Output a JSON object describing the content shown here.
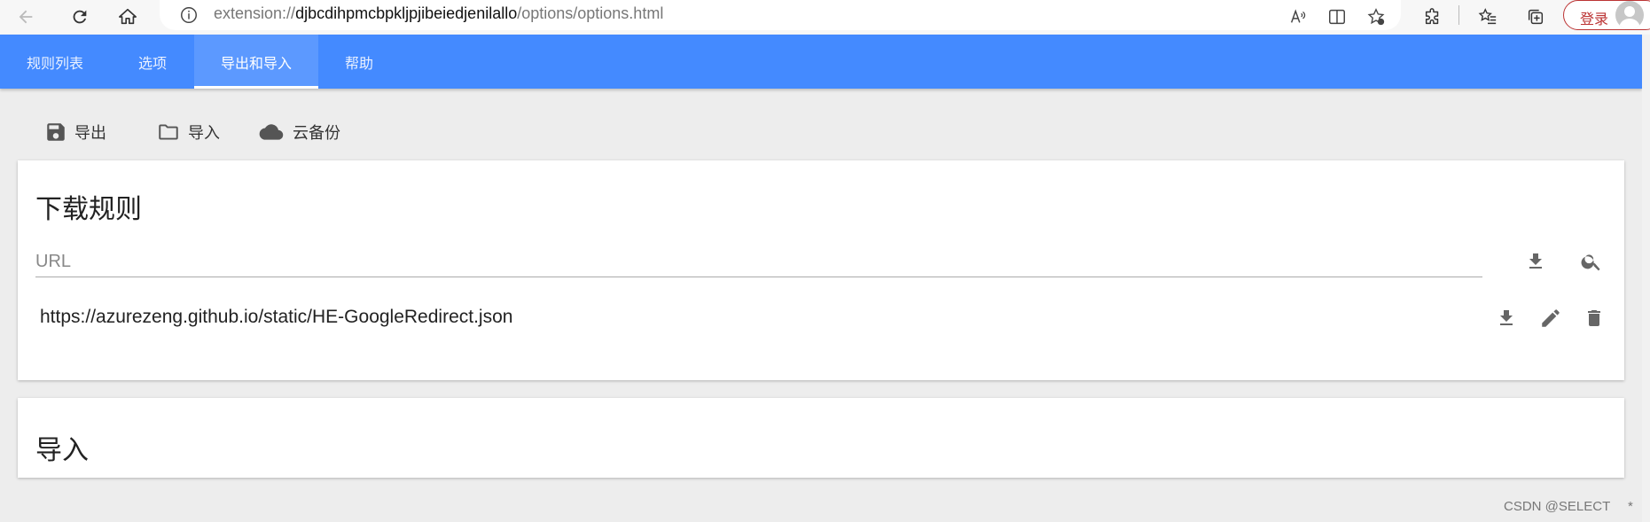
{
  "browser": {
    "url_prefix": "extension://",
    "url_host": "djbcdihpmcbpkljpjibeiedjenilallo",
    "url_path": "/options/options.html",
    "login_label": "登录"
  },
  "tabs": [
    {
      "label": "规则列表",
      "active": false
    },
    {
      "label": "选项",
      "active": false
    },
    {
      "label": "导出和导入",
      "active": true
    },
    {
      "label": "帮助",
      "active": false
    }
  ],
  "toolbar": {
    "export_label": "导出",
    "import_label": "导入",
    "cloud_label": "云备份"
  },
  "download_card": {
    "title": "下载规则",
    "url_placeholder": "URL",
    "rules": [
      {
        "url": "https://azurezeng.github.io/static/HE-GoogleRedirect.json"
      }
    ]
  },
  "import_card": {
    "title": "导入"
  },
  "footer": {
    "watermark": "CSDN @SELECT",
    "mark": "*"
  }
}
